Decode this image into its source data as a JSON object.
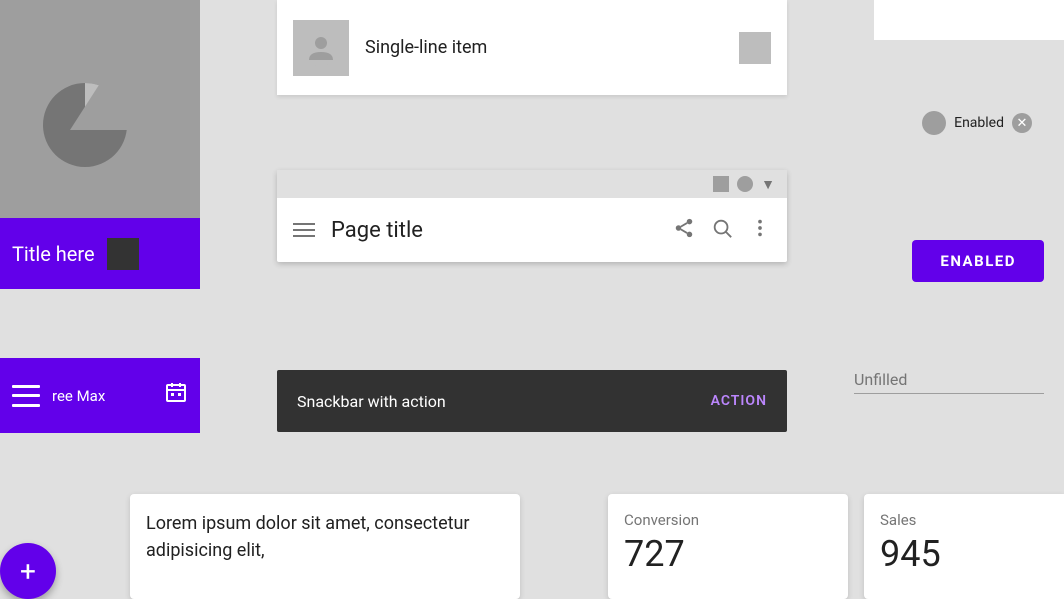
{
  "logo": {
    "aria": "app-logo"
  },
  "titleBar": {
    "text": "Title here",
    "iconAria": "title-icon"
  },
  "menuBar": {
    "label": "ree Max",
    "iconAria": "calendar-icon"
  },
  "fab": {
    "label": "+"
  },
  "listItem": {
    "text": "Single-line item",
    "avatarAria": "list-avatar",
    "actionAria": "list-action-icon"
  },
  "appBar": {
    "title": "Page title",
    "hamburgerAria": "hamburger-icon",
    "shareAria": "share-icon",
    "searchAria": "search-icon",
    "moreAria": "more-icon",
    "windowBtns": [
      "square-btn",
      "circle-btn",
      "chevron-btn"
    ]
  },
  "snackbar": {
    "text": "Snackbar with action",
    "actionLabel": "ACTION"
  },
  "chip": {
    "label": "Enabled",
    "closeAria": "close-icon"
  },
  "buttons": {
    "enabledFilled": "ENABLED"
  },
  "inputs": {
    "unfilled": {
      "value": "Unfilled",
      "placeholder": "Unfilled"
    }
  },
  "cards": {
    "left": {
      "text": "Lorem ipsum dolor sit amet, consectetur adipisicing elit,"
    },
    "mid": {
      "label": "Conversion",
      "value": "727"
    },
    "right": {
      "label": "Sales",
      "value": "945"
    }
  }
}
